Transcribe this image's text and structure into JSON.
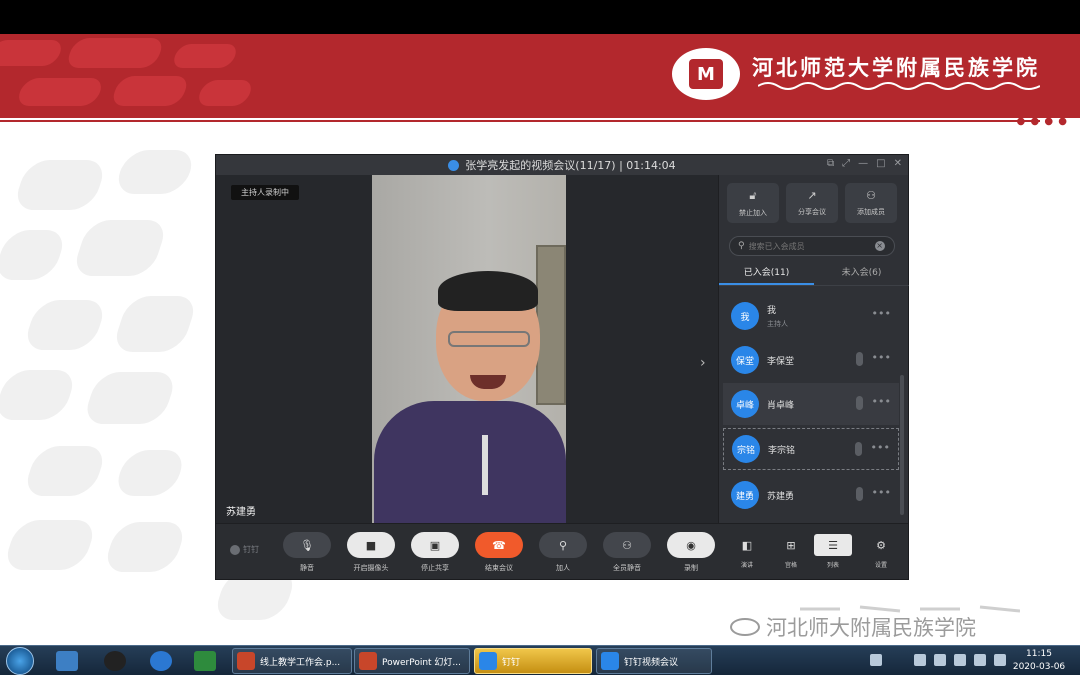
{
  "slide": {
    "school_name": "河北师范大学附属民族学院",
    "logo_letter": "M",
    "watermark_text": "河北师大附属民族学院"
  },
  "meeting": {
    "title": "张学亮发起的视频会议(11/17) | 01:14:04",
    "recording_badge": "主持人录制中",
    "speaker_name": "苏建勇",
    "panel_buttons": [
      {
        "label": "禁止加入",
        "icon": "lock-icon"
      },
      {
        "label": "分享会议",
        "icon": "share-icon"
      },
      {
        "label": "添加成员",
        "icon": "add-member-icon"
      }
    ],
    "search_placeholder": "搜索已入会成员",
    "tabs": [
      {
        "label": "已入会(11)",
        "active": true
      },
      {
        "label": "未入会(6)",
        "active": false
      }
    ],
    "members": [
      {
        "avatar": "我",
        "name": "我",
        "role": "主持人"
      },
      {
        "avatar": "保堂",
        "name": "李保堂"
      },
      {
        "avatar": "卓峰",
        "name": "肖卓峰"
      },
      {
        "avatar": "宗铭",
        "name": "李宗铭"
      },
      {
        "avatar": "建勇",
        "name": "苏建勇"
      }
    ],
    "toolbar": {
      "brand": "钉钉",
      "buttons": [
        {
          "label": "静音",
          "icon": "mic-icon"
        },
        {
          "label": "开启摄像头",
          "icon": "camera-icon"
        },
        {
          "label": "停止共享",
          "icon": "share-screen-icon"
        },
        {
          "label": "结束会议",
          "icon": "hangup-icon"
        },
        {
          "label": "加人",
          "icon": "add-person-icon"
        },
        {
          "label": "全员静音",
          "icon": "mute-all-icon"
        },
        {
          "label": "录制",
          "icon": "record-icon"
        }
      ],
      "views": [
        {
          "label": "演讲",
          "icon": "speaker-view-icon"
        },
        {
          "label": "宫格",
          "icon": "grid-view-icon"
        },
        {
          "label": "列表",
          "icon": "list-view-icon"
        }
      ],
      "settings_label": "设置"
    }
  },
  "taskbar": {
    "tasks": [
      {
        "label": "线上教学工作会.p...",
        "active": false
      },
      {
        "label": "PowerPoint 幻灯...",
        "active": false
      },
      {
        "label": "钉钉",
        "active": true
      },
      {
        "label": "钉钉视频会议",
        "active": false
      }
    ],
    "time": "11:15",
    "date": "2020-03-06"
  },
  "colors": {
    "banner_red": "#b3282d",
    "accent_blue": "#2a86e8",
    "end_call": "#f15a2b"
  }
}
